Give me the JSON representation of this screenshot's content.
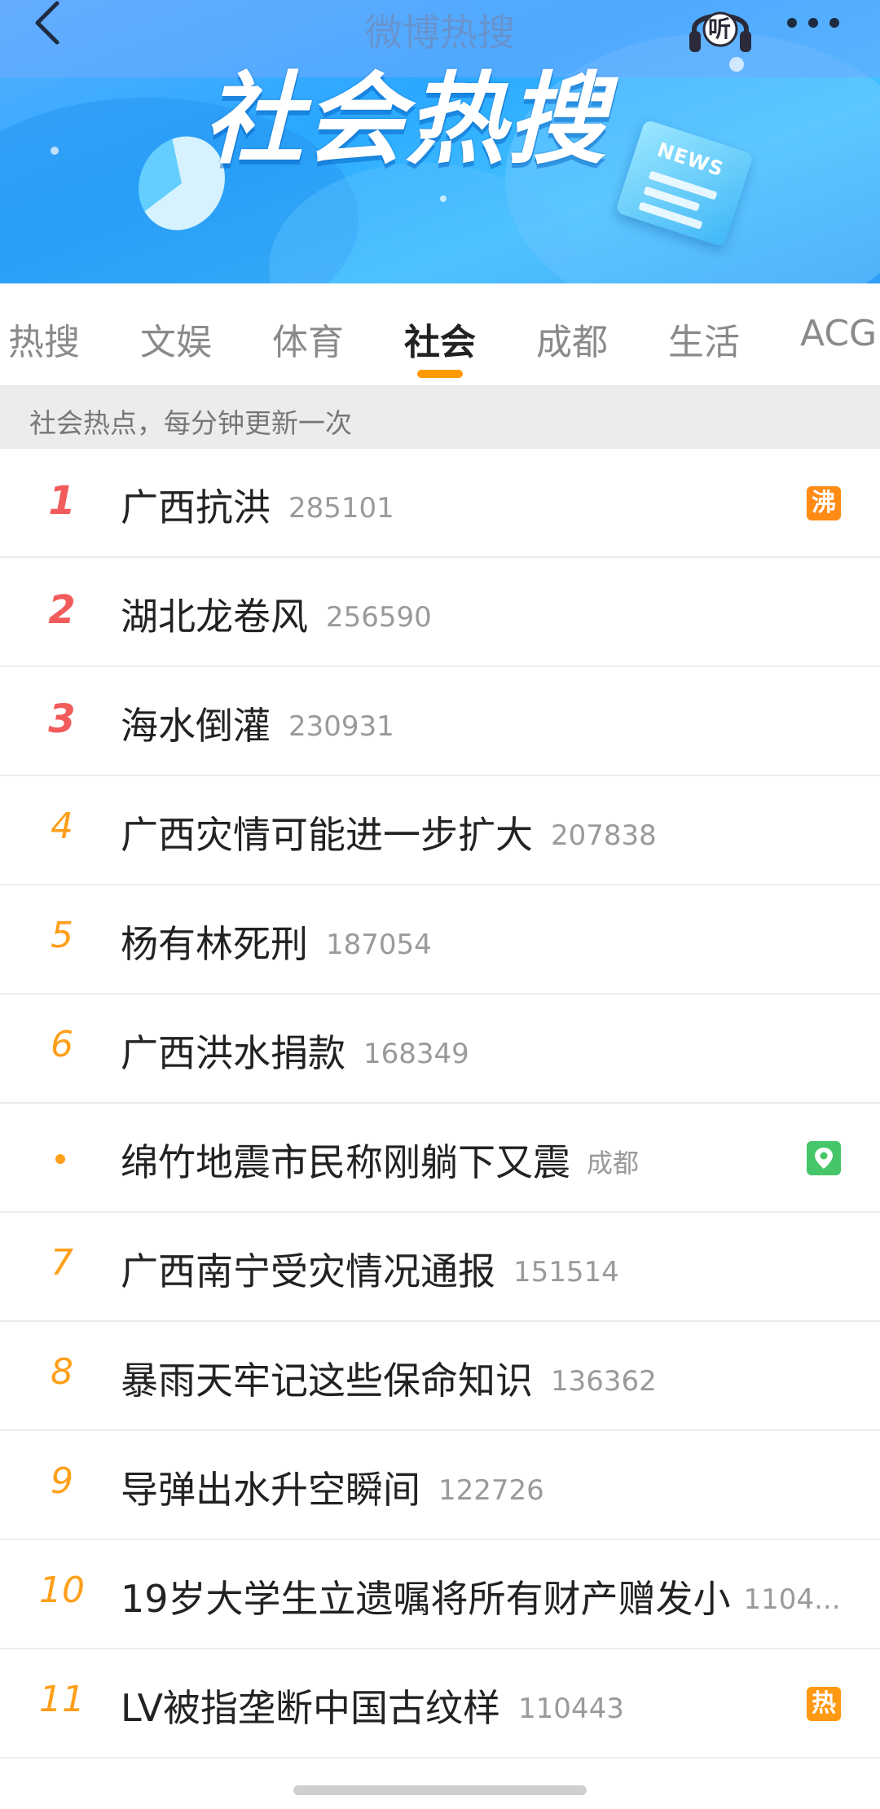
{
  "header": {
    "nav_title": "微博热搜",
    "banner_title": "社会热搜",
    "banner_news_label": "NEWS",
    "listen_label": "听"
  },
  "tabs": [
    {
      "label": "热搜"
    },
    {
      "label": "文娱"
    },
    {
      "label": "体育"
    },
    {
      "label": "社会",
      "active": true
    },
    {
      "label": "成都"
    },
    {
      "label": "生活"
    },
    {
      "label": "ACG"
    }
  ],
  "notice": "社会热点，每分钟更新一次",
  "list": [
    {
      "rank": "1",
      "title": "广西抗洪",
      "count": "285101",
      "badge": "沸"
    },
    {
      "rank": "2",
      "title": "湖北龙卷风",
      "count": "256590"
    },
    {
      "rank": "3",
      "title": "海水倒灌",
      "count": "230931"
    },
    {
      "rank": "4",
      "title": "广西灾情可能进一步扩大",
      "count": "207838"
    },
    {
      "rank": "5",
      "title": "杨有林死刑",
      "count": "187054"
    },
    {
      "rank": "6",
      "title": "广西洪水捐款",
      "count": "168349"
    },
    {
      "rank": "•",
      "title": "绵竹地震市民称刚躺下又震",
      "location": "成都",
      "badge_icon": "location-pin-icon"
    },
    {
      "rank": "7",
      "title": "广西南宁受灾情况通报",
      "count": "151514"
    },
    {
      "rank": "8",
      "title": "暴雨天牢记这些保命知识",
      "count": "136362"
    },
    {
      "rank": "9",
      "title": "导弹出水升空瞬间",
      "count": "122726"
    },
    {
      "rank": "10",
      "title": "19岁大学生立遗嘱将所有财产赠发小",
      "count": "1104..."
    },
    {
      "rank": "11",
      "title": "LV被指垄断中国古纹样",
      "count": "110443",
      "badge": "热"
    }
  ],
  "colors": {
    "accent": "#ff9a00",
    "top_rank": "#f25b5b",
    "rank": "#ff9f1a",
    "badge_boil": "#ff8a14",
    "badge_hot": "#ff9812",
    "badge_location": "#45c668"
  }
}
